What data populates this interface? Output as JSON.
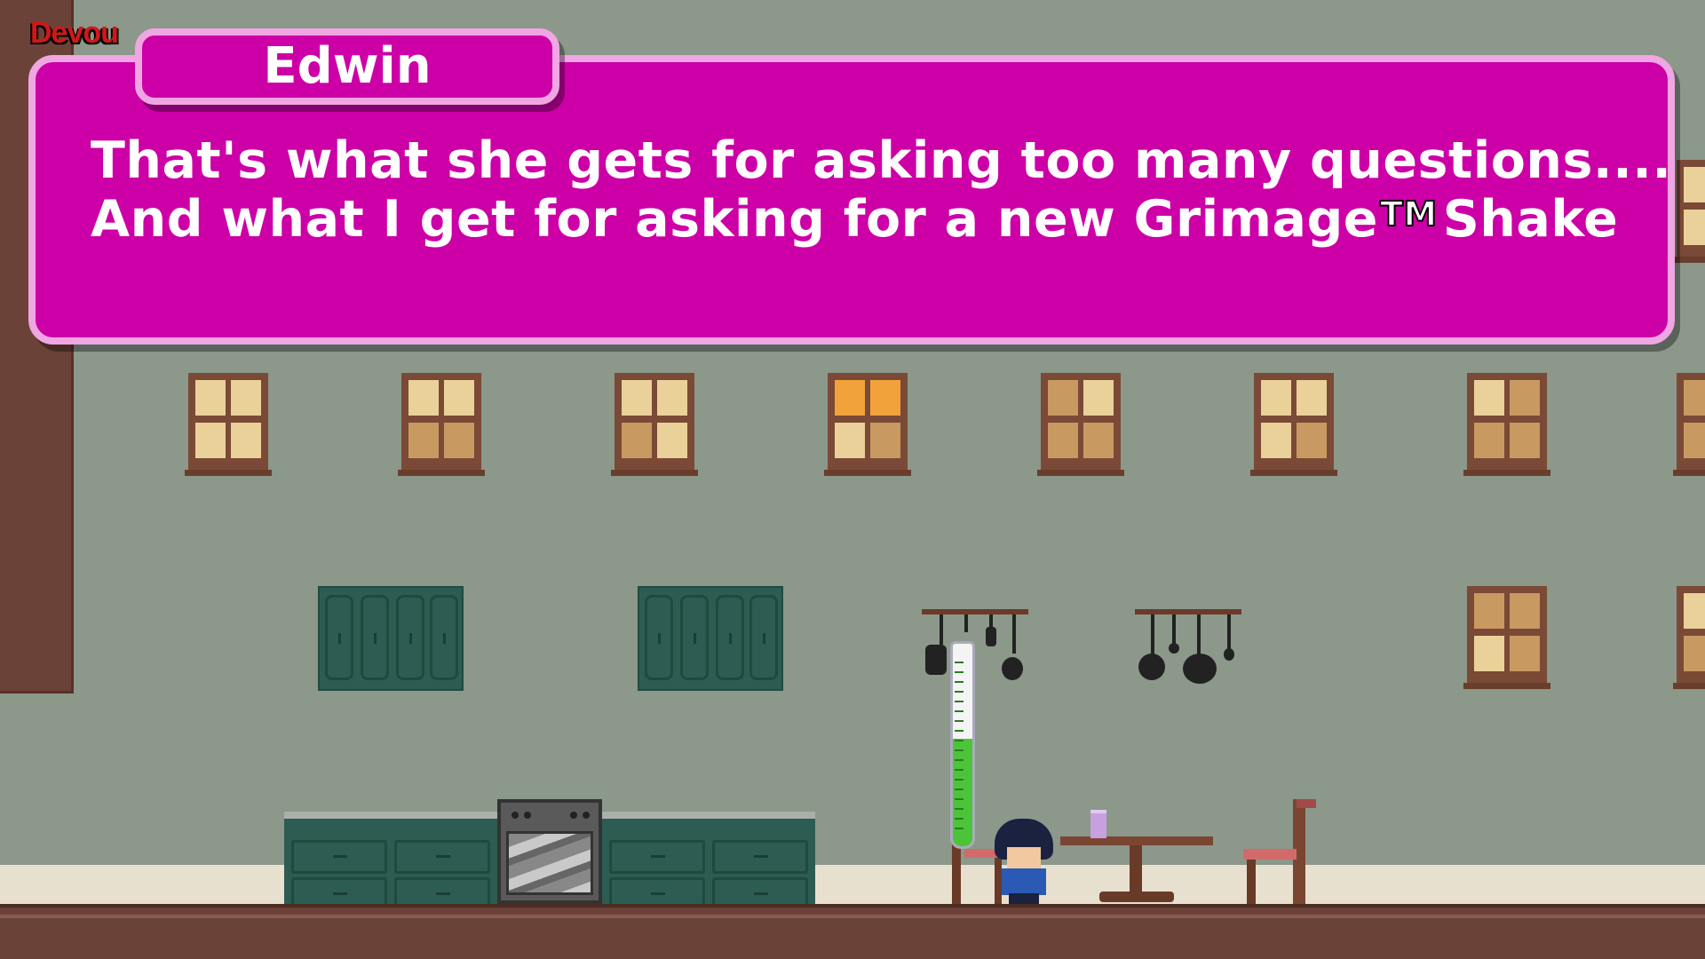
{
  "hud": {
    "title": "Devou"
  },
  "dialog": {
    "speaker": "Edwin",
    "line1": "That's what she gets for asking too many questions....",
    "line2_a": "And what I get for asking for a new Grimage",
    "line2_tm": "TM",
    "line2_b": "Shake"
  },
  "gauge": {
    "level": 0.53,
    "color": "#4cc43a"
  },
  "colors": {
    "dialog_bg": "#cc00a6",
    "dialog_border": "#f0a6e2",
    "wall": "#8b988a",
    "floor": "#6b4238"
  }
}
